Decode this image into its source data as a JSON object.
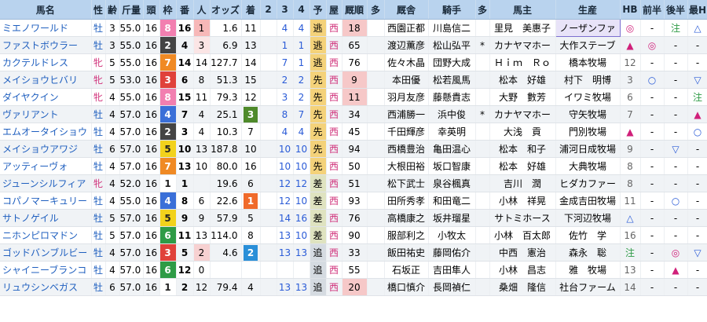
{
  "headers": [
    "馬名",
    "性",
    "齢",
    "斤量",
    "頭",
    "枠",
    "番",
    "人",
    "オッズ",
    "着",
    "2",
    "3",
    "4",
    "予",
    "屋",
    "厩順",
    "多",
    "厩舎",
    "騎手",
    "多",
    "馬主",
    "生産",
    "HB",
    "前半",
    "後半",
    "最H"
  ],
  "waku_colors": {
    "1": "#ffffff",
    "2": "#444444",
    "3": "#e0413a",
    "4": "#3a6fd8",
    "5": "#f2d21c",
    "6": "#2e9b46",
    "7": "#f08a24",
    "8": "#f27fb0"
  },
  "rows": [
    {
      "name": "ミエノワールド",
      "sex": "牡",
      "age": "3",
      "kin": "55.0",
      "tou": "16",
      "waku": "8",
      "ban": "16",
      "nin": "1",
      "odds": "1.6",
      "chaku": "11",
      "p2": "",
      "p3": "4",
      "p4": "4",
      "yo": "逃",
      "ya": "西",
      "kyu": "18",
      "ta": "",
      "kyusha": "西園正都",
      "jockey": "川島信二",
      "ta2": "",
      "owner": "里見　美惠子",
      "breeder": "ノーザンファ",
      "hb": "◎",
      "zen": "-",
      "kou": "注",
      "saih": "△"
    },
    {
      "name": "ファストボウラー",
      "sex": "牡",
      "age": "3",
      "kin": "55.0",
      "tou": "16",
      "waku": "2",
      "ban": "4",
      "nin": "3",
      "odds": "6.9",
      "chaku": "13",
      "p2": "",
      "p3": "1",
      "p4": "1",
      "yo": "逃",
      "ya": "西",
      "kyu": "65",
      "ta": "",
      "kyusha": "渡辺薫彦",
      "jockey": "松山弘平",
      "ta2": "*",
      "owner": "カナヤマホー",
      "breeder": "大作ステーブ",
      "hb": "▲",
      "zen": "◎",
      "kou": "-",
      "saih": "-"
    },
    {
      "name": "カクテルドレス",
      "sex": "牝",
      "age": "5",
      "kin": "55.0",
      "tou": "16",
      "waku": "7",
      "ban": "14",
      "nin": "14",
      "odds": "127.7",
      "chaku": "14",
      "p2": "",
      "p3": "7",
      "p4": "1",
      "yo": "逃",
      "ya": "西",
      "kyu": "76",
      "ta": "",
      "kyusha": "佐々木晶",
      "jockey": "団野大成",
      "ta2": "",
      "owner": "Ｈｉｍ　Ｒｏ",
      "breeder": "橋本牧場",
      "hb": "12",
      "zen": "-",
      "kou": "-",
      "saih": "-"
    },
    {
      "name": "メイショウヒバリ",
      "sex": "牝",
      "age": "5",
      "kin": "53.0",
      "tou": "16",
      "waku": "3",
      "ban": "6",
      "nin": "8",
      "odds": "51.3",
      "chaku": "15",
      "p2": "",
      "p3": "2",
      "p4": "2",
      "yo": "先",
      "ya": "西",
      "kyu": "9",
      "ta": "",
      "kyusha": "本田優",
      "jockey": "松若風馬",
      "ta2": "",
      "owner": "松本　好雄",
      "breeder": "村下　明博",
      "hb": "3",
      "zen": "○",
      "kou": "-",
      "saih": "▽"
    },
    {
      "name": "ダイヤクイン",
      "sex": "牝",
      "age": "4",
      "kin": "55.0",
      "tou": "16",
      "waku": "8",
      "ban": "15",
      "nin": "11",
      "odds": "79.3",
      "chaku": "12",
      "p2": "",
      "p3": "3",
      "p4": "2",
      "yo": "先",
      "ya": "西",
      "kyu": "11",
      "ta": "",
      "kyusha": "羽月友彦",
      "jockey": "藤懸貴志",
      "ta2": "",
      "owner": "大野　數芳",
      "breeder": "イワミ牧場",
      "hb": "6",
      "zen": "-",
      "kou": "-",
      "saih": "注"
    },
    {
      "name": "ヴァリアント",
      "sex": "牡",
      "age": "4",
      "kin": "57.0",
      "tou": "16",
      "waku": "4",
      "ban": "7",
      "nin": "4",
      "odds": "25.1",
      "chaku": "3",
      "p2": "",
      "p3": "8",
      "p4": "7",
      "yo": "先",
      "ya": "西",
      "kyu": "34",
      "ta": "",
      "kyusha": "西浦勝一",
      "jockey": "浜中俊",
      "ta2": "*",
      "owner": "カナヤマホー",
      "breeder": "守矢牧場",
      "hb": "7",
      "zen": "-",
      "kou": "-",
      "saih": "▲"
    },
    {
      "name": "エムオータイショウ",
      "sex": "牡",
      "age": "4",
      "kin": "57.0",
      "tou": "16",
      "waku": "2",
      "ban": "3",
      "nin": "4",
      "odds": "10.3",
      "chaku": "7",
      "p2": "",
      "p3": "4",
      "p4": "4",
      "yo": "先",
      "ya": "西",
      "kyu": "45",
      "ta": "",
      "kyusha": "千田輝彦",
      "jockey": "幸英明",
      "ta2": "",
      "owner": "大浅　貢",
      "breeder": "門別牧場",
      "hb": "▲",
      "zen": "-",
      "kou": "-",
      "saih": "○"
    },
    {
      "name": "メイショウアワジ",
      "sex": "牡",
      "age": "6",
      "kin": "57.0",
      "tou": "16",
      "waku": "5",
      "ban": "10",
      "nin": "13",
      "odds": "187.8",
      "chaku": "10",
      "p2": "",
      "p3": "10",
      "p4": "10",
      "yo": "先",
      "ya": "西",
      "kyu": "94",
      "ta": "",
      "kyusha": "西橋豊治",
      "jockey": "亀田温心",
      "ta2": "",
      "owner": "松本　和子",
      "breeder": "浦河日成牧場",
      "hb": "9",
      "zen": "-",
      "kou": "▽",
      "saih": "-"
    },
    {
      "name": "アッティーヴォ",
      "sex": "牡",
      "age": "4",
      "kin": "57.0",
      "tou": "16",
      "waku": "7",
      "ban": "13",
      "nin": "10",
      "odds": "80.0",
      "chaku": "16",
      "p2": "",
      "p3": "10",
      "p4": "10",
      "yo": "先",
      "ya": "西",
      "kyu": "50",
      "ta": "",
      "kyusha": "大根田裕",
      "jockey": "坂口智康",
      "ta2": "",
      "owner": "松本　好雄",
      "breeder": "大典牧場",
      "hb": "8",
      "zen": "-",
      "kou": "-",
      "saih": "-"
    },
    {
      "name": "ジューンシルフィア",
      "sex": "牝",
      "age": "4",
      "kin": "52.0",
      "tou": "16",
      "waku": "1",
      "ban": "1",
      "nin": "",
      "odds": "19.6",
      "chaku": "6",
      "p2": "",
      "p3": "12",
      "p4": "12",
      "yo": "差",
      "ya": "西",
      "kyu": "51",
      "ta": "",
      "kyusha": "松下武士",
      "jockey": "泉谷楓真",
      "ta2": "",
      "owner": "吉川　潤",
      "breeder": "ヒダカファー",
      "hb": "8",
      "zen": "-",
      "kou": "-",
      "saih": "-"
    },
    {
      "name": "コパノマーキュリー",
      "sex": "牡",
      "age": "4",
      "kin": "55.0",
      "tou": "16",
      "waku": "4",
      "ban": "8",
      "nin": "6",
      "odds": "22.6",
      "chaku": "1",
      "p2": "",
      "p3": "12",
      "p4": "10",
      "yo": "差",
      "ya": "西",
      "kyu": "93",
      "ta": "",
      "kyusha": "田所秀孝",
      "jockey": "和田竜二",
      "ta2": "",
      "owner": "小林　祥晃",
      "breeder": "金成吉田牧場",
      "hb": "11",
      "zen": "-",
      "kou": "○",
      "saih": "-"
    },
    {
      "name": "サトノゲイル",
      "sex": "牡",
      "age": "5",
      "kin": "57.0",
      "tou": "16",
      "waku": "5",
      "ban": "9",
      "nin": "9",
      "odds": "57.9",
      "chaku": "5",
      "p2": "",
      "p3": "14",
      "p4": "16",
      "yo": "差",
      "ya": "西",
      "kyu": "76",
      "ta": "",
      "kyusha": "高橋康之",
      "jockey": "坂井瑠星",
      "ta2": "",
      "owner": "サトミホース",
      "breeder": "下河辺牧場",
      "hb": "△",
      "zen": "-",
      "kou": "-",
      "saih": "-"
    },
    {
      "name": "ニホンピロマドン",
      "sex": "牡",
      "age": "5",
      "kin": "57.0",
      "tou": "16",
      "waku": "6",
      "ban": "11",
      "nin": "13",
      "odds": "114.0",
      "chaku": "8",
      "p2": "",
      "p3": "13",
      "p4": "10",
      "yo": "差",
      "ya": "西",
      "kyu": "90",
      "ta": "",
      "kyusha": "服部利之",
      "jockey": "小牧太",
      "ta2": "",
      "owner": "小林　百太郎",
      "breeder": "佐竹　学",
      "hb": "16",
      "zen": "-",
      "kou": "-",
      "saih": "-"
    },
    {
      "name": "ゴッドバンブルビー",
      "sex": "牡",
      "age": "4",
      "kin": "57.0",
      "tou": "16",
      "waku": "3",
      "ban": "5",
      "nin": "2",
      "odds": "4.6",
      "chaku": "2",
      "p2": "",
      "p3": "13",
      "p4": "13",
      "yo": "追",
      "ya": "西",
      "kyu": "33",
      "ta": "",
      "kyusha": "飯田祐史",
      "jockey": "藤岡佑介",
      "ta2": "",
      "owner": "中西　憲治",
      "breeder": "森永　聡",
      "hb": "注",
      "zen": "-",
      "kou": "◎",
      "saih": "▽"
    },
    {
      "name": "シャイニーブランコ",
      "sex": "牡",
      "age": "4",
      "kin": "57.0",
      "tou": "16",
      "waku": "6",
      "ban": "12",
      "nin": "0",
      "odds": "",
      "chaku": "",
      "p2": "",
      "p3": "",
      "p4": "",
      "yo": "追",
      "ya": "西",
      "kyu": "55",
      "ta": "",
      "kyusha": "石坂正",
      "jockey": "吉田隼人",
      "ta2": "",
      "owner": "小林　昌志",
      "breeder": "雅　牧場",
      "hb": "13",
      "zen": "-",
      "kou": "▲",
      "saih": "-"
    },
    {
      "name": "リュウシンベガス",
      "sex": "牡",
      "age": "6",
      "kin": "57.0",
      "tou": "16",
      "waku": "1",
      "ban": "2",
      "nin": "12",
      "odds": "79.4",
      "chaku": "4",
      "p2": "",
      "p3": "13",
      "p4": "13",
      "yo": "追",
      "ya": "西",
      "kyu": "20",
      "ta": "",
      "kyusha": "橋口慎介",
      "jockey": "長岡禎仁",
      "ta2": "",
      "owner": "桑畑　隆信",
      "breeder": "社台ファーム",
      "hb": "14",
      "zen": "-",
      "kou": "-",
      "saih": "-"
    }
  ]
}
